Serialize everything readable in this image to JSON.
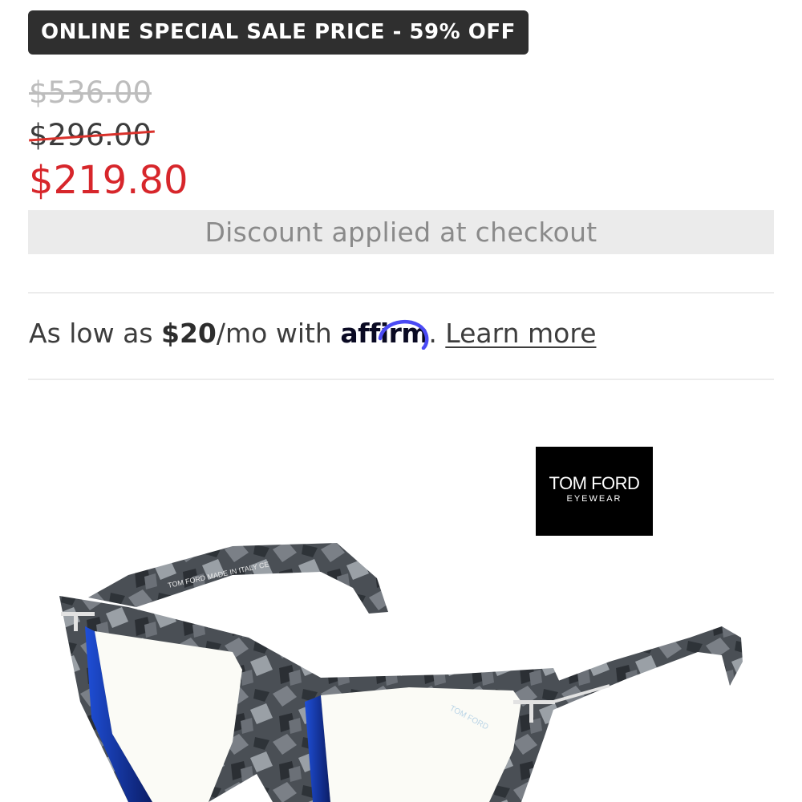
{
  "badge": {
    "text": "ONLINE SPECIAL SALE PRICE - 59% OFF"
  },
  "pricing": {
    "msrp": "$536.00",
    "list_price": "$296.00",
    "sale_price": "$219.80",
    "discount_note": "Discount applied at checkout"
  },
  "financing": {
    "prefix": "As low as ",
    "amount": "$20",
    "suffix": "/mo with ",
    "provider": "affirm",
    "after": ". ",
    "link_label": "Learn more",
    "provider_accent_color": "#4a4af4"
  },
  "product": {
    "brand_line1": "TOM FORD",
    "brand_line2": "EYEWEAR",
    "temple_print": "TOM FORD MADE IN ITALY CE",
    "lens_print": "TOM FORD"
  },
  "colors": {
    "sale_red": "#d7262b",
    "badge_bg": "#2f2f2f",
    "discount_bg": "#ebebeb"
  }
}
